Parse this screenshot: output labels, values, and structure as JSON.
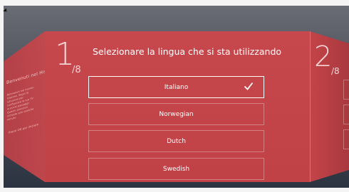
{
  "left_panel": {
    "title": "Benvenuti nel Hisense SMART TV",
    "text": "Benvenuti nel mondo Hisense. Segui le istruzioni per configurare la tua TV in pochi passaggi. Questo processo richiede solo qualche minuto.",
    "sub": "Premi OK per iniziare"
  },
  "main_panel": {
    "step": "1",
    "total": "/8",
    "heading": "Selezionare la lingua che si sta utilizzando",
    "options": [
      {
        "label": "Italiano",
        "selected": true
      },
      {
        "label": "Norwegian",
        "selected": false
      },
      {
        "label": "Dutch",
        "selected": false
      },
      {
        "label": "Swedish",
        "selected": false
      }
    ]
  },
  "right_panel": {
    "step": "2",
    "total": "/8"
  },
  "colors": {
    "panel": "#c5464b",
    "background": "#4a4e58",
    "text": "#ffffff"
  }
}
